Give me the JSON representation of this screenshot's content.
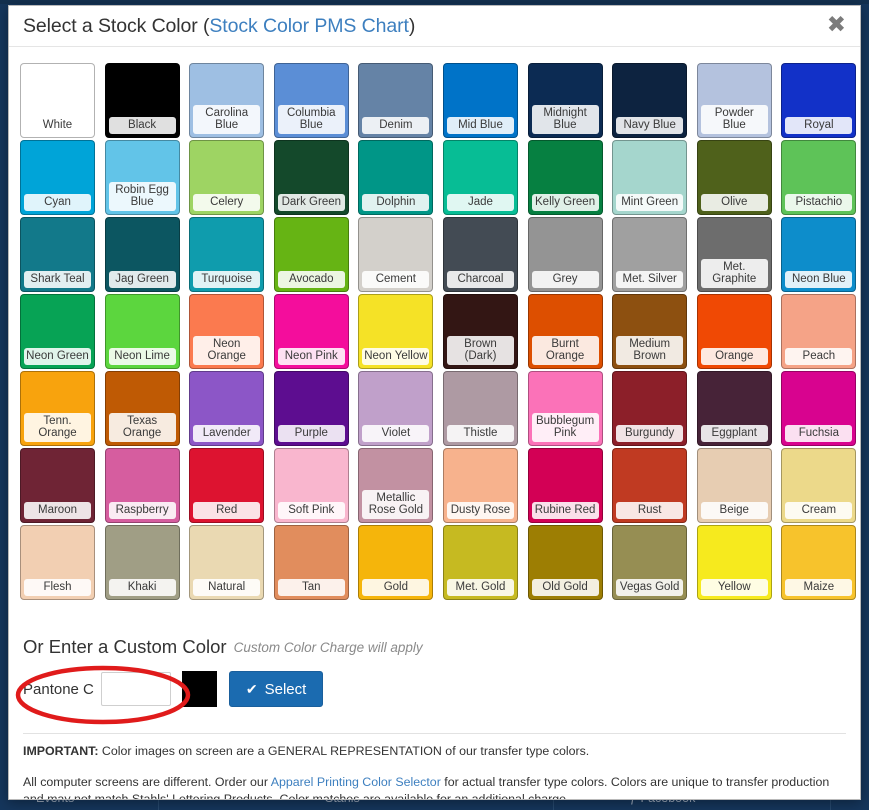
{
  "background": {
    "footer_cells": [
      "Events",
      "Stahls'",
      "Facebook"
    ]
  },
  "modal": {
    "title_main": "Select a Stock Color (",
    "title_link": "Stock Color PMS Chart",
    "title_close_paren": ")",
    "close_icon": "✖"
  },
  "swatches": [
    {
      "name": "White",
      "hex": "#ffffff"
    },
    {
      "name": "Black",
      "hex": "#000000"
    },
    {
      "name": "Carolina\nBlue",
      "hex": "#9ebfe3"
    },
    {
      "name": "Columbia\nBlue",
      "hex": "#5b8ed6"
    },
    {
      "name": "Denim",
      "hex": "#6583a6"
    },
    {
      "name": "Mid Blue",
      "hex": "#0073c8"
    },
    {
      "name": "Midnight\nBlue",
      "hex": "#0c2b53"
    },
    {
      "name": "Navy Blue",
      "hex": "#0d2340"
    },
    {
      "name": "Powder Blue",
      "hex": "#b4c2de"
    },
    {
      "name": "Royal",
      "hex": "#1231c8"
    },
    {
      "name": "Cyan",
      "hex": "#00a4d8"
    },
    {
      "name": "Robin Egg\nBlue",
      "hex": "#62c4e8"
    },
    {
      "name": "Celery",
      "hex": "#9ed463"
    },
    {
      "name": "Dark Green",
      "hex": "#14492b"
    },
    {
      "name": "Dolphin",
      "hex": "#009687"
    },
    {
      "name": "Jade",
      "hex": "#07bd95"
    },
    {
      "name": "Kelly Green",
      "hex": "#068041"
    },
    {
      "name": "Mint Green",
      "hex": "#a5d6cd"
    },
    {
      "name": "Olive",
      "hex": "#4f611b"
    },
    {
      "name": "Pistachio",
      "hex": "#5ec358"
    },
    {
      "name": "Shark Teal",
      "hex": "#12798a"
    },
    {
      "name": "Jag Green",
      "hex": "#0c5661"
    },
    {
      "name": "Turquoise",
      "hex": "#0f9cad"
    },
    {
      "name": "Avocado",
      "hex": "#66b414"
    },
    {
      "name": "Cement",
      "hex": "#d3d0cb"
    },
    {
      "name": "Charcoal",
      "hex": "#434b54"
    },
    {
      "name": "Grey",
      "hex": "#949494"
    },
    {
      "name": "Met. Silver",
      "hex": "#a0a0a0"
    },
    {
      "name": "Met.\nGraphite",
      "hex": "#6d6d6d"
    },
    {
      "name": "Neon Blue",
      "hex": "#0d8dcb"
    },
    {
      "name": "Neon Green",
      "hex": "#07a355"
    },
    {
      "name": "Neon Lime",
      "hex": "#5cd63e"
    },
    {
      "name": "Neon\nOrange",
      "hex": "#fb7a4f"
    },
    {
      "name": "Neon Pink",
      "hex": "#f40d9c"
    },
    {
      "name": "Neon Yellow",
      "hex": "#f5e226"
    },
    {
      "name": "Brown (Dark)",
      "hex": "#331614"
    },
    {
      "name": "Burnt\nOrange",
      "hex": "#dd4f00"
    },
    {
      "name": "Medium\nBrown",
      "hex": "#8d5010"
    },
    {
      "name": "Orange",
      "hex": "#f04904"
    },
    {
      "name": "Peach",
      "hex": "#f5a387"
    },
    {
      "name": "Tenn.\nOrange",
      "hex": "#f8a30d"
    },
    {
      "name": "Texas\nOrange",
      "hex": "#bf5a04"
    },
    {
      "name": "Lavender",
      "hex": "#8c56c7"
    },
    {
      "name": "Purple",
      "hex": "#5d0d90"
    },
    {
      "name": "Violet",
      "hex": "#c0a0ca"
    },
    {
      "name": "Thistle",
      "hex": "#ae9aa3"
    },
    {
      "name": "Bubblegum\nPink",
      "hex": "#fb72b8"
    },
    {
      "name": "Burgundy",
      "hex": "#8c1f29"
    },
    {
      "name": "Eggplant",
      "hex": "#472338"
    },
    {
      "name": "Fuchsia",
      "hex": "#d8038f"
    },
    {
      "name": "Maroon",
      "hex": "#6f2435"
    },
    {
      "name": "Raspberry",
      "hex": "#d65d9f"
    },
    {
      "name": "Red",
      "hex": "#dd1330"
    },
    {
      "name": "Soft Pink",
      "hex": "#f9b6ce"
    },
    {
      "name": "Metallic\nRose Gold",
      "hex": "#c291a2"
    },
    {
      "name": "Dusty Rose",
      "hex": "#f7b28d"
    },
    {
      "name": "Rubine Red",
      "hex": "#d30055"
    },
    {
      "name": "Rust",
      "hex": "#c03a22"
    },
    {
      "name": "Beige",
      "hex": "#e7cdb2"
    },
    {
      "name": "Cream",
      "hex": "#ecd98a"
    },
    {
      "name": "Flesh",
      "hex": "#f2cfb2"
    },
    {
      "name": "Khaki",
      "hex": "#a09e85"
    },
    {
      "name": "Natural",
      "hex": "#ead9b2"
    },
    {
      "name": "Tan",
      "hex": "#e18d5d"
    },
    {
      "name": "Gold",
      "hex": "#f5b50b"
    },
    {
      "name": "Met. Gold",
      "hex": "#c6ba21"
    },
    {
      "name": "Old Gold",
      "hex": "#9d7e03"
    },
    {
      "name": "Vegas Gold",
      "hex": "#968e53"
    },
    {
      "name": "Yellow",
      "hex": "#f6ea1e"
    },
    {
      "name": "Maize",
      "hex": "#f7c32c"
    }
  ],
  "custom": {
    "title": "Or Enter a Custom Color",
    "note": "Custom Color Charge will apply",
    "pantone_label": "Pantone C",
    "pantone_value": "",
    "pantone_placeholder": "",
    "preview_hex": "#000000",
    "select_label": "Select",
    "select_check_icon": "✔"
  },
  "notes": {
    "important_label": "IMPORTANT:",
    "important_text": " Color images on screen are a GENERAL REPRESENTATION of our transfer type colors.",
    "disclaimer_pre": "All computer screens are different. Order our ",
    "disclaimer_link": "Apparel Printing Color Selector",
    "disclaimer_post": " for actual transfer type colors. Colors are unique to transfer production and may not match Stahls' Lettering Products. Color matches are available for an additional charge."
  },
  "annotation": {
    "shape": "red-ellipse",
    "color": "#e01b1b"
  }
}
